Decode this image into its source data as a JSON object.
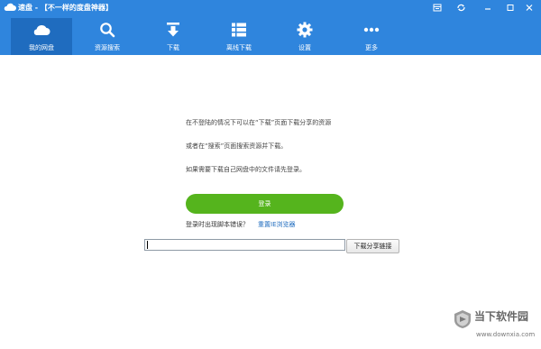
{
  "window": {
    "app_name": "速盘",
    "subtitle": " - 【不一样的度盘神器】"
  },
  "nav": {
    "items": [
      {
        "label": "我的网盘",
        "icon": "cloud-icon",
        "active": true
      },
      {
        "label": "资源搜索",
        "icon": "search-icon",
        "active": false
      },
      {
        "label": "下载",
        "icon": "download-icon",
        "active": false
      },
      {
        "label": "离线下载",
        "icon": "list-icon",
        "active": false
      },
      {
        "label": "设置",
        "icon": "gear-icon",
        "active": false
      },
      {
        "label": "更多",
        "icon": "more-dots-icon",
        "active": false
      }
    ]
  },
  "main": {
    "tip_1": "在不登陆的情况下可以在“下载”页面下载分享的资源",
    "tip_2": "或者在“搜索”页面搜索资源并下载。",
    "tip_3": "如果需要下载自己网盘中的文件请先登录。",
    "login_label": "登录",
    "error_question": "登录时出现脚本错误？",
    "reset_ie_link": "重置IE浏览器",
    "share_link_value": "",
    "share_link_placeholder": "",
    "download_share_label": "下载分享链接"
  },
  "watermark": {
    "brand": "当下软件园",
    "url": "www.downxia.com"
  },
  "colors": {
    "header_bg": "#2f85dd",
    "nav_active_bg": "#1f6cbf",
    "login_btn": "#55b41d",
    "link": "#1f6cbf"
  }
}
